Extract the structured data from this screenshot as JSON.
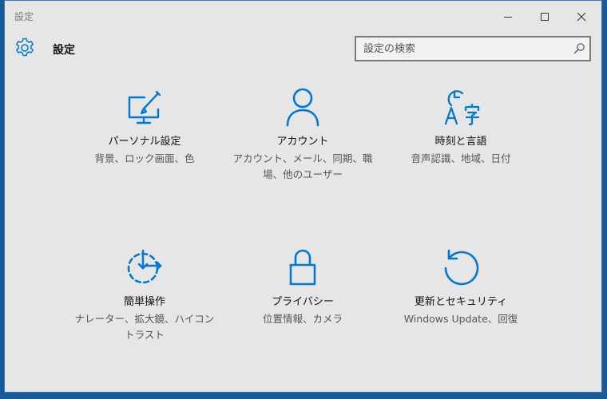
{
  "window": {
    "title": "設定"
  },
  "header": {
    "title": "設定",
    "search_placeholder": "設定の検索"
  },
  "tiles": [
    {
      "label": "パーソナル設定",
      "desc": "背景、ロック画面、色",
      "icon": "personalization-icon"
    },
    {
      "label": "アカウント",
      "desc": "アカウント、メール、同期、職場、他のユーザー",
      "icon": "account-icon"
    },
    {
      "label": "時刻と言語",
      "desc": "音声認識、地域、日付",
      "icon": "time-language-icon"
    },
    {
      "label": "簡単操作",
      "desc": "ナレーター、拡大鏡、ハイコントラスト",
      "icon": "ease-of-access-icon"
    },
    {
      "label": "プライバシー",
      "desc": "位置情報、カメラ",
      "icon": "lock-icon"
    },
    {
      "label": "更新とセキュリティ",
      "desc": "Windows Update、回復",
      "icon": "update-icon"
    }
  ],
  "colors": {
    "accent": "#0078d7",
    "window_bg": "#e6e6e6",
    "desktop": "#1a5a96"
  }
}
